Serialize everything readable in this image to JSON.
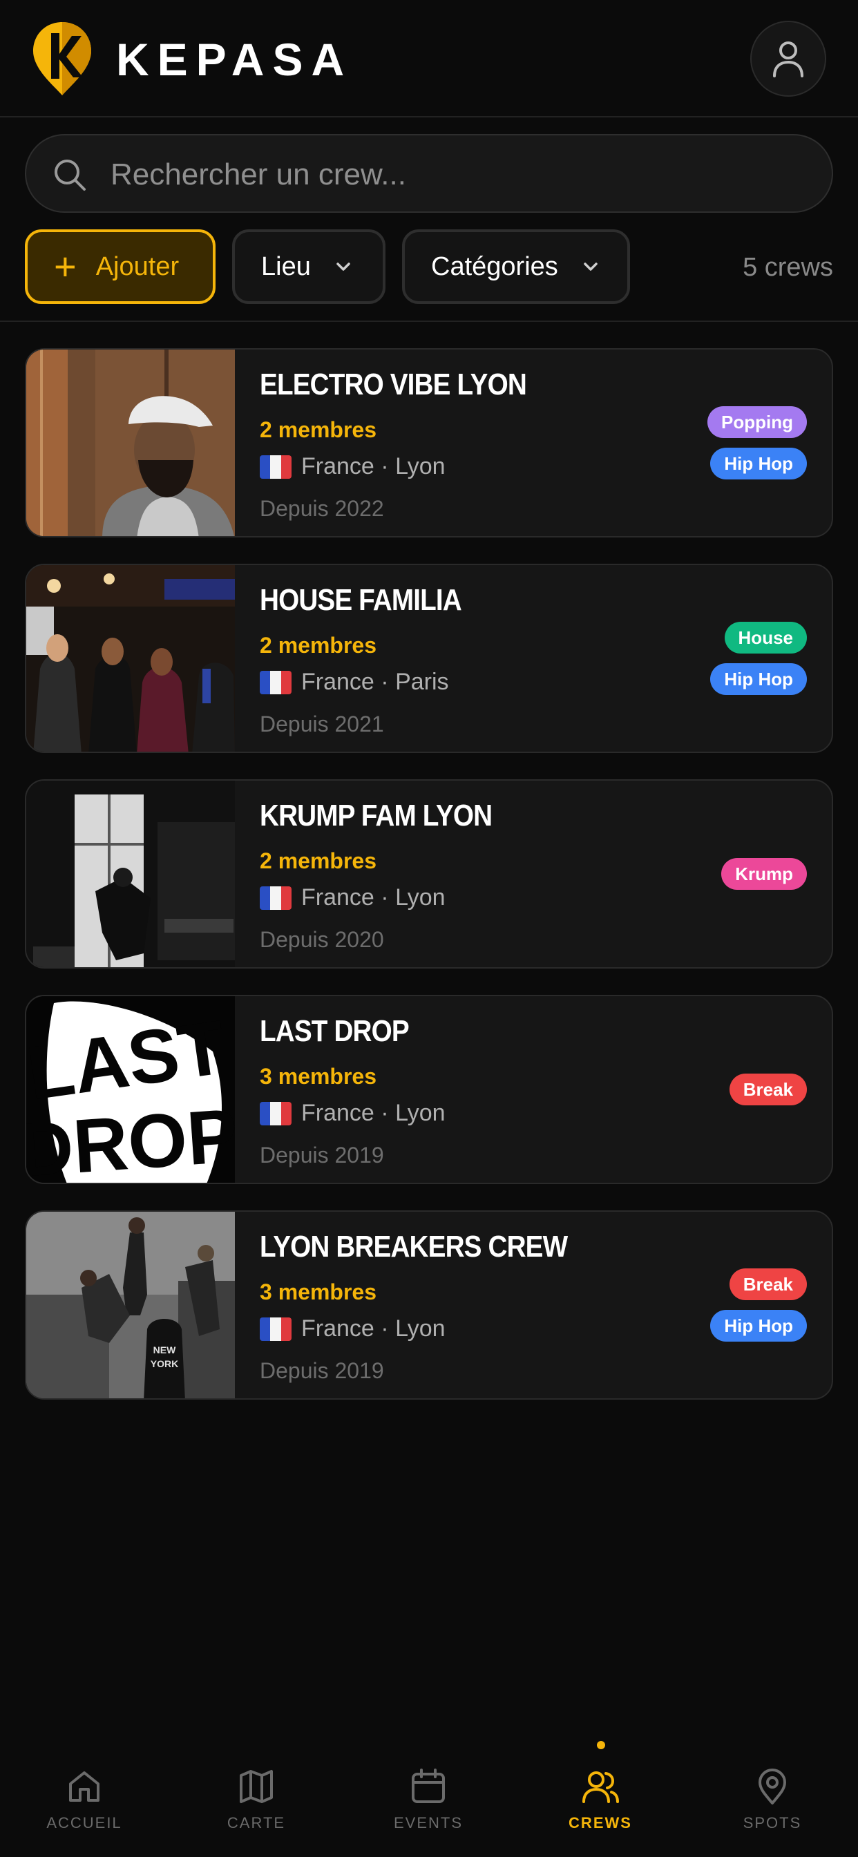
{
  "app": {
    "name": "KEPASA"
  },
  "search": {
    "placeholder": "Rechercher un crew..."
  },
  "filters": {
    "add_label": "Ajouter",
    "location_label": "Lieu",
    "categories_label": "Catégories",
    "count_label": "5 crews"
  },
  "colors": {
    "accent": "#f5b50a",
    "popping": "#a47af0",
    "hiphop": "#3b82f6",
    "house": "#10b981",
    "krump": "#ec4899",
    "break": "#ef4444"
  },
  "crews": [
    {
      "name": "ELECTRO VIBE LYON",
      "members": "2 membres",
      "country": "France",
      "separator": "·",
      "city": "Lyon",
      "since": "Depuis 2022",
      "tags": [
        {
          "label": "Popping",
          "color": "#a47af0"
        },
        {
          "label": "Hip Hop",
          "color": "#3b82f6"
        }
      ]
    },
    {
      "name": "HOUSE FAMILIA",
      "members": "2 membres",
      "country": "France",
      "separator": "·",
      "city": "Paris",
      "since": "Depuis 2021",
      "tags": [
        {
          "label": "House",
          "color": "#10b981"
        },
        {
          "label": "Hip Hop",
          "color": "#3b82f6"
        }
      ]
    },
    {
      "name": "KRUMP FAM LYON",
      "members": "2 membres",
      "country": "France",
      "separator": "·",
      "city": "Lyon",
      "since": "Depuis 2020",
      "tags": [
        {
          "label": "Krump",
          "color": "#ec4899"
        }
      ]
    },
    {
      "name": "LAST DROP",
      "members": "3 membres",
      "country": "France",
      "separator": "·",
      "city": "Lyon",
      "since": "Depuis 2019",
      "tags": [
        {
          "label": "Break",
          "color": "#ef4444"
        }
      ]
    },
    {
      "name": "LYON BREAKERS CREW",
      "members": "3 membres",
      "country": "France",
      "separator": "·",
      "city": "Lyon",
      "since": "Depuis 2019",
      "tags": [
        {
          "label": "Break",
          "color": "#ef4444"
        },
        {
          "label": "Hip Hop",
          "color": "#3b82f6"
        }
      ]
    }
  ],
  "nav": {
    "home": "ACCUEIL",
    "map": "CARTE",
    "events": "EVENTS",
    "crews": "CREWS",
    "spots": "SPOTS",
    "active": "crews"
  },
  "thumbnails": {
    "lastdrop_text_1": "LAST",
    "lastdrop_text_2": "DROP",
    "shirt_text_1": "NEW",
    "shirt_text_2": "YORK"
  }
}
